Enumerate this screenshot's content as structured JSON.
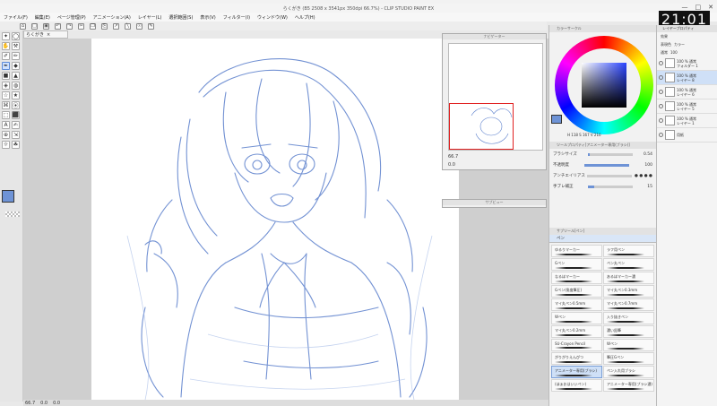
{
  "window": {
    "title": "らくがき (B5 2508 x 3541px 350dpi 66.7%) - CLIP STUDIO PAINT EX",
    "controls": [
      "—",
      "□",
      "✕"
    ]
  },
  "clock": "21:01",
  "menu": [
    "ファイル(F)",
    "編集(E)",
    "ページ管理(P)",
    "アニメーション(A)",
    "レイヤー(L)",
    "選択範囲(S)",
    "表示(V)",
    "フィルター(I)",
    "ウィンドウ(W)",
    "ヘルプ(H)"
  ],
  "toolbar": {
    "buttons": [
      "⌂",
      "□",
      "▣",
      "↶",
      "↷",
      "✂",
      "❐",
      "⎘",
      "↗",
      "╲",
      "☉",
      "✎"
    ]
  },
  "document_tab": {
    "label": "らくがき",
    "close": "×"
  },
  "tools": [
    "✦",
    "◯",
    "✋",
    "⚒",
    "✐",
    "✏",
    "✒",
    "◆",
    "■",
    "▲",
    "◈",
    "◍",
    "☆",
    "★",
    "⌘",
    "⦿",
    "⬚",
    "⬛",
    "A",
    "✍",
    "⊕",
    "⇲",
    "☼",
    "☘"
  ],
  "navigator": {
    "title": "ナビゲーター",
    "zoom": "66.7",
    "rotation": "0.0"
  },
  "subview": {
    "title": "サブビュー"
  },
  "color_panel": {
    "title": "カラーサークル",
    "readout": "H 118  S 167  V 210"
  },
  "brush_panel": {
    "title": "ツールプロパティ[アニメーター専用(ブラシ)]",
    "rows": [
      {
        "label": "ブラシサイズ",
        "value": "0.54",
        "fill": 0.05
      },
      {
        "label": "不透明度",
        "value": "100",
        "fill": 1.0
      },
      {
        "label": "アンチエイリアス",
        "value": "● ● ● ●",
        "fill": 0
      },
      {
        "label": "手ブレ補正",
        "value": "15",
        "fill": 0.15
      }
    ]
  },
  "subtool": {
    "title": "サブツール[ペン]",
    "tab": "ペン",
    "brushes": [
      {
        "name": "ゆるりマーカー"
      },
      {
        "name": "ラフ用ペン"
      },
      {
        "name": "Gペン"
      },
      {
        "name": "ペン丸ペン"
      },
      {
        "name": "なるほマーカー"
      },
      {
        "name": "あるほマーカー濃"
      },
      {
        "name": "Gペン(角度筆圧)"
      },
      {
        "name": "マイ丸ペン0.3mm"
      },
      {
        "name": "マイ丸ペン0.5mm"
      },
      {
        "name": "マイ丸ペン0.7mm"
      },
      {
        "name": "Wペン"
      },
      {
        "name": "入り抜きペン"
      },
      {
        "name": "マイ丸ペン0.2mm"
      },
      {
        "name": "濃い鉛筆"
      },
      {
        "name": "SU-Crayon Pencil"
      },
      {
        "name": "Wペン"
      },
      {
        "name": "がりがりえんぴつ"
      },
      {
        "name": "筆圧Gペン"
      },
      {
        "name": "アニメーター専用(ブラシ)",
        "selected": true
      },
      {
        "name": "ペン入れ用ブラシ"
      },
      {
        "name": "(ほぁおはいいペン)"
      },
      {
        "name": "アニメーター専用(ブラシ濃)"
      }
    ]
  },
  "layer_panel": {
    "title": "レイヤープロパティ",
    "controls": [
      "効果",
      "表現色",
      "カラー"
    ],
    "blend": "通常",
    "opacity": "100",
    "layers": [
      {
        "mode": "100 % 通常",
        "name": "フォルダー 1"
      },
      {
        "mode": "100 % 通常",
        "name": "レイヤー 8",
        "selected": true
      },
      {
        "mode": "100 % 通常",
        "name": "レイヤー 6"
      },
      {
        "mode": "100 % 通常",
        "name": "レイヤー 5"
      },
      {
        "mode": "100 % 通常",
        "name": "レイヤー 1"
      },
      {
        "mode": "",
        "name": "用紙"
      }
    ]
  },
  "status": {
    "zoom": "66.7",
    "rotation": "0.0",
    "pos": "0.0"
  },
  "colors": {
    "accent": "#6e93d6",
    "sketch": "#5b7fcc",
    "frame": "#e02020"
  }
}
